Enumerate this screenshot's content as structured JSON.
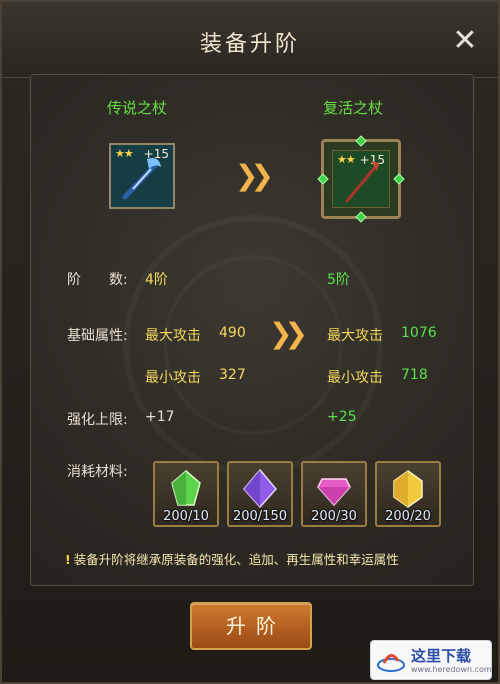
{
  "dialog": {
    "title": "装备升阶",
    "close_icon": "close-icon"
  },
  "current_item": {
    "name": "传说之杖",
    "stars": "★★",
    "enhance": "+15",
    "color": "#66e046"
  },
  "target_item": {
    "name": "复活之杖",
    "stars": "★★",
    "enhance": "+15",
    "color": "#66e046"
  },
  "stats": {
    "tier_label": "阶　　数:",
    "tier_current": "4阶",
    "tier_target": "5阶",
    "base_label": "基础属性:",
    "max_attack_label": "最大攻击",
    "max_attack_current": "490",
    "max_attack_target": "1076",
    "min_attack_label": "最小攻击",
    "min_attack_current": "327",
    "min_attack_target": "718",
    "enhance_cap_label": "强化上限:",
    "enhance_cap_current": "+17",
    "enhance_cap_target": "+25"
  },
  "materials": {
    "label": "消耗材料:",
    "items": [
      {
        "count": "200/10",
        "color": "#5cd34a"
      },
      {
        "count": "200/150",
        "color": "#8f5be8"
      },
      {
        "count": "200/30",
        "color": "#e85cc8"
      },
      {
        "count": "200/20",
        "color": "#f2c93a"
      }
    ]
  },
  "notice": {
    "text": "装备升阶将继承原装备的强化、追加、再生属性和幸运属性"
  },
  "upgrade_button": {
    "label": "升阶"
  },
  "watermark": {
    "text": "这里下载",
    "url": "www.heredown.com"
  }
}
